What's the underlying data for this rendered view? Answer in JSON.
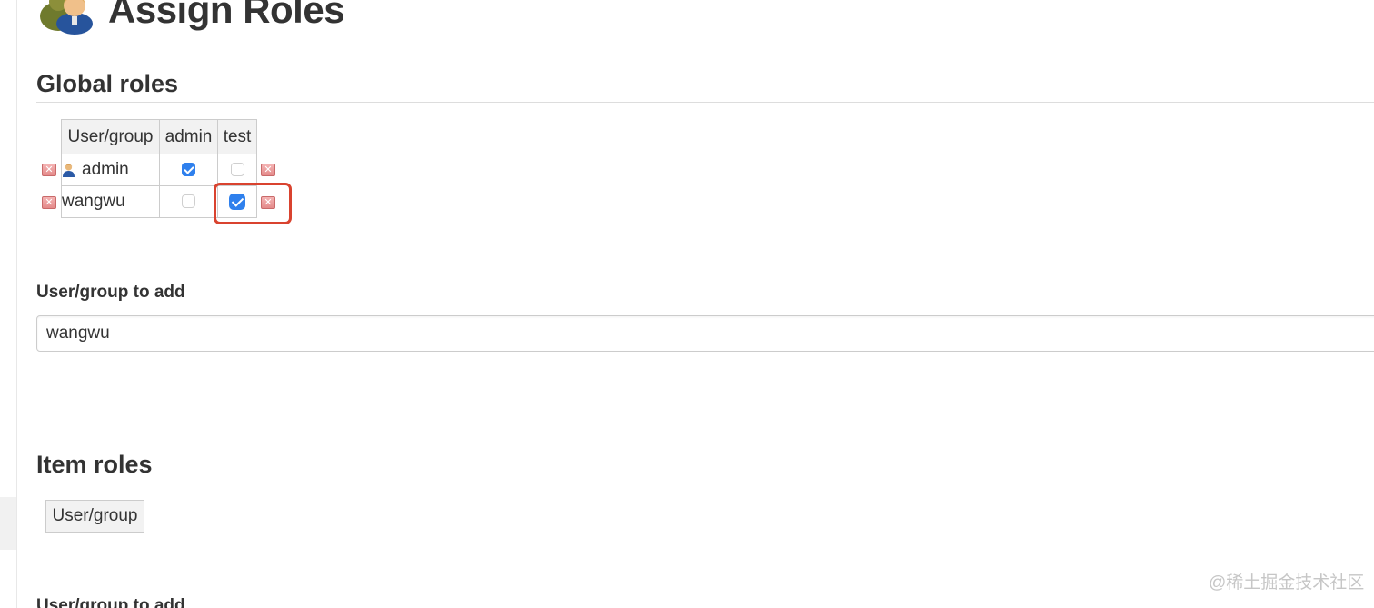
{
  "page": {
    "title": "Assign Roles",
    "title_icon": "users-icon"
  },
  "global_roles": {
    "heading": "Global roles",
    "columns": [
      "User/group",
      "admin",
      "test"
    ],
    "rows": [
      {
        "user": "admin",
        "has_user_icon": true,
        "admin": true,
        "test": false
      },
      {
        "user": "wangwu",
        "has_user_icon": false,
        "admin": false,
        "test": true
      }
    ],
    "add_label": "User/group to add",
    "add_input_value": "wangwu"
  },
  "item_roles": {
    "heading": "Item roles",
    "columns": [
      "User/group"
    ],
    "add_label": "User/group to add"
  },
  "icons": {
    "delete": "delete-icon",
    "user": "user-icon"
  },
  "colors": {
    "checkbox_checked": "#2f80ed",
    "highlight_border": "#d9432f",
    "delete_button": "#e48a8a"
  },
  "watermark": "@稀土掘金技术社区"
}
